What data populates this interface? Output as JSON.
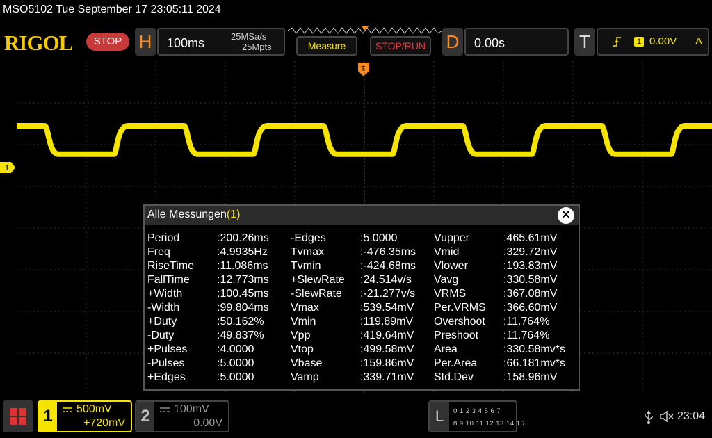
{
  "title": "MSO5102  Tue September 17 23:05:11 2024",
  "colors": {
    "trace": "#f5e400",
    "brand": "#f5c800",
    "stop": "#c83a3a",
    "accent": "#ff8a1e"
  },
  "toolbar": {
    "logo": "RIGOL",
    "run_state": "STOP",
    "h_letter": "H",
    "timebase": "100ms",
    "sample_rate": "25MSa/s",
    "memory_depth": "25Mpts",
    "measure_label": "Measure",
    "stoprun_label": "STOP/RUN",
    "d_letter": "D",
    "delay": "0.00s",
    "t_letter": "T",
    "trigger_source": "1",
    "trigger_level": "0.00V",
    "trigger_mode": "A"
  },
  "trace": {
    "channel_marker": "1",
    "trigger_marker": "T",
    "period_ms": 200.26,
    "high_level_v": 0.4996,
    "low_level_v": 0.1599
  },
  "dialog": {
    "title": "Alle Messungen",
    "title_suffix": "(1)",
    "columns": [
      [
        {
          "name": "Period",
          "value": ":200.26ms"
        },
        {
          "name": "Freq",
          "value": ":4.9935Hz"
        },
        {
          "name": "RiseTime",
          "value": ":11.086ms"
        },
        {
          "name": "FallTime",
          "value": ":12.773ms"
        },
        {
          "name": "+Width",
          "value": ":100.45ms"
        },
        {
          "name": "-Width",
          "value": ":99.804ms"
        },
        {
          "name": "+Duty",
          "value": ":50.162%"
        },
        {
          "name": "-Duty",
          "value": ":49.837%"
        },
        {
          "name": "+Pulses",
          "value": ":4.0000"
        },
        {
          "name": "-Pulses",
          "value": ":5.0000"
        },
        {
          "name": "+Edges",
          "value": ":5.0000"
        }
      ],
      [
        {
          "name": "-Edges",
          "value": ":5.0000"
        },
        {
          "name": "Tvmax",
          "value": ":-476.35ms"
        },
        {
          "name": "Tvmin",
          "value": ":-424.68ms"
        },
        {
          "name": "+SlewRate",
          "value": ":24.514v/s"
        },
        {
          "name": "-SlewRate",
          "value": ":-21.277v/s"
        },
        {
          "name": "Vmax",
          "value": ":539.54mV"
        },
        {
          "name": "Vmin",
          "value": ":119.89mV"
        },
        {
          "name": "Vpp",
          "value": ":419.64mV"
        },
        {
          "name": "Vtop",
          "value": ":499.58mV"
        },
        {
          "name": "Vbase",
          "value": ":159.86mV"
        },
        {
          "name": "Vamp",
          "value": ":339.71mV"
        }
      ],
      [
        {
          "name": "Vupper",
          "value": ":465.61mV"
        },
        {
          "name": "Vmid",
          "value": ":329.72mV"
        },
        {
          "name": "Vlower",
          "value": ":193.83mV"
        },
        {
          "name": "Vavg",
          "value": ":330.58mV"
        },
        {
          "name": "VRMS",
          "value": ":367.08mV"
        },
        {
          "name": "Per.VRMS",
          "value": ":366.60mV"
        },
        {
          "name": "Overshoot",
          "value": ":11.764%"
        },
        {
          "name": "Preshoot",
          "value": ":11.764%"
        },
        {
          "name": "Area",
          "value": ":330.58mv*s"
        },
        {
          "name": "Per.Area",
          "value": ":66.181mv*s"
        },
        {
          "name": "Std.Dev",
          "value": ":158.96mV"
        }
      ]
    ]
  },
  "bottom": {
    "ch1_num": "1",
    "ch1_scale": "500mV",
    "ch1_offset": "+720mV",
    "ch2_num": "2",
    "ch2_scale": "100mV",
    "ch2_offset": "0.00V",
    "logic_letter": "L",
    "logic_row1": "0 1 2 3  4 5 6 7",
    "logic_row2": "8 9 10 11 12 13 14 15",
    "time": "23:04"
  }
}
